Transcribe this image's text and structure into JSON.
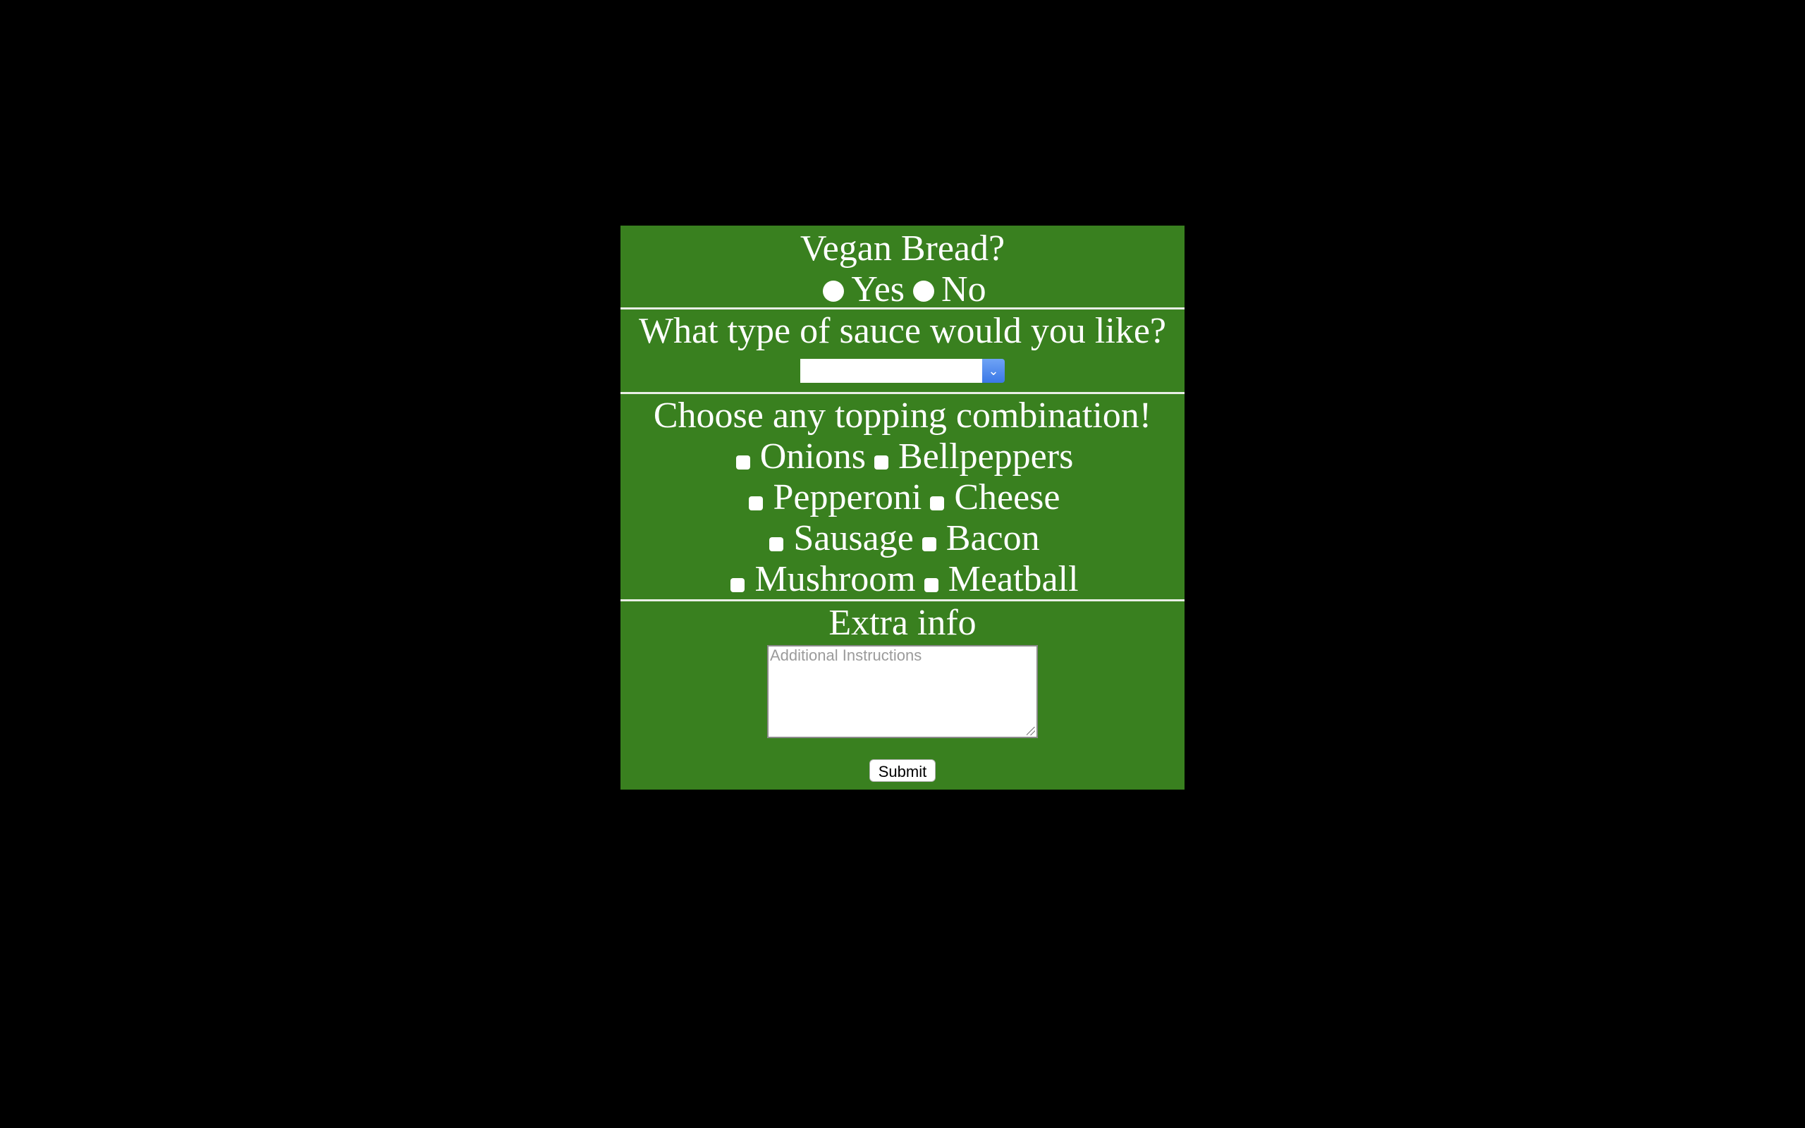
{
  "vegan": {
    "heading": "Vegan Bread?",
    "options": [
      "Yes",
      "No"
    ]
  },
  "sauce": {
    "heading": "What type of sauce would you like?",
    "selected": ""
  },
  "toppings": {
    "heading": "Choose any topping combination!",
    "items": [
      "Onions",
      "Bellpeppers",
      "Pepperoni",
      "Cheese",
      "Sausage",
      "Bacon",
      "Mushroom",
      "Meatball"
    ]
  },
  "extra": {
    "heading": "Extra info",
    "placeholder": "Additional Instructions"
  },
  "submit_label": "Submit",
  "colors": {
    "page_background": "#000000",
    "panel_background": "#39801f",
    "text": "#ffffff"
  }
}
